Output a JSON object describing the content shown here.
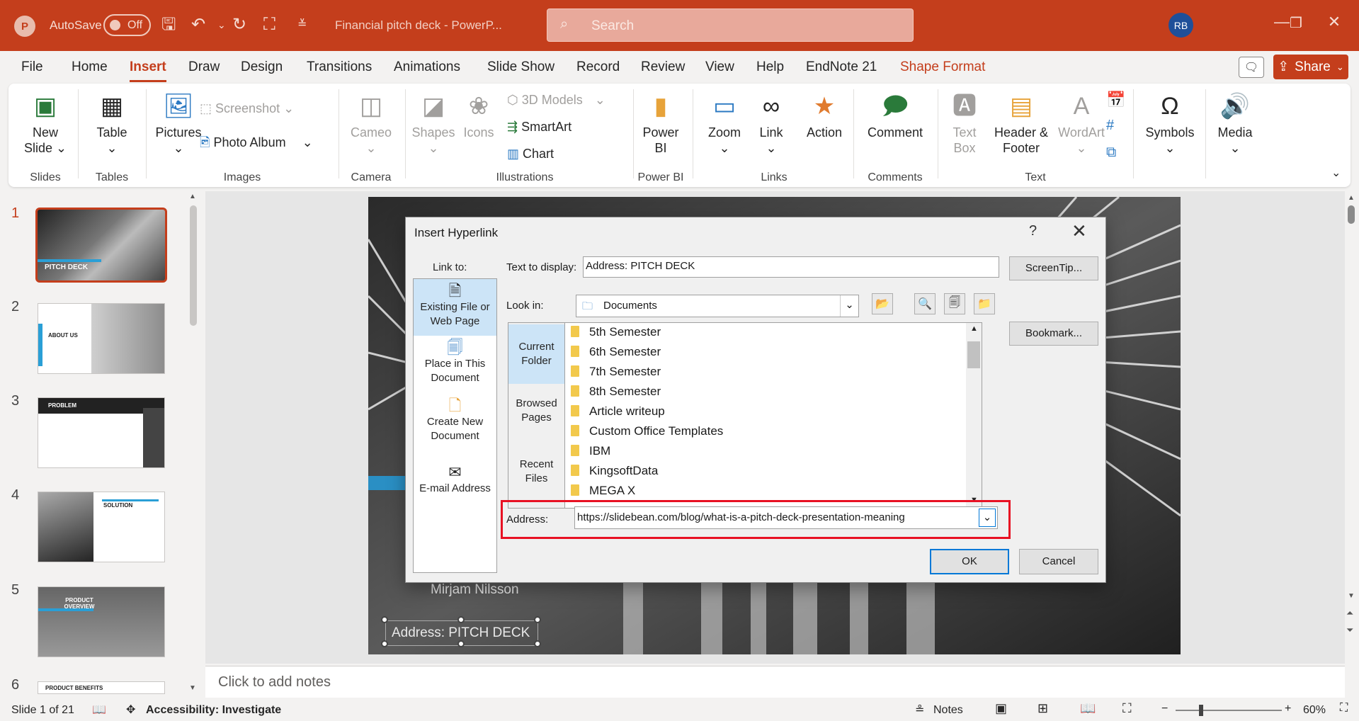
{
  "titlebar": {
    "autosave_label": "AutoSave",
    "autosave_state": "Off",
    "doc_title": "Financial pitch deck  -  PowerP...",
    "search_placeholder": "Search",
    "user_initials": "RB"
  },
  "menu": {
    "tabs": [
      "File",
      "Home",
      "Insert",
      "Draw",
      "Design",
      "Transitions",
      "Animations",
      "Slide Show",
      "Record",
      "Review",
      "View",
      "Help",
      "EndNote 21",
      "Shape Format"
    ],
    "active_tab": "Insert",
    "share_label": "Share"
  },
  "ribbon": {
    "slides": {
      "new_slide": "New Slide",
      "group": "Slides"
    },
    "tables": {
      "table": "Table",
      "group": "Tables"
    },
    "images": {
      "pictures": "Pictures",
      "screenshot": "Screenshot",
      "photo_album": "Photo Album",
      "group": "Images"
    },
    "camera": {
      "cameo": "Cameo",
      "group": "Camera"
    },
    "illustrations": {
      "shapes": "Shapes",
      "icons": "Icons",
      "models": "3D Models",
      "smartart": "SmartArt",
      "chart": "Chart",
      "group": "Illustrations"
    },
    "powerbi": {
      "power_bi": "Power BI",
      "group": "Power BI"
    },
    "links": {
      "zoom": "Zoom",
      "link": "Link",
      "action": "Action",
      "group": "Links"
    },
    "comments": {
      "comment": "Comment",
      "group": "Comments"
    },
    "text": {
      "text_box": "Text Box",
      "header_footer": "Header & Footer",
      "wordart": "WordArt",
      "group": "Text"
    },
    "symbols": {
      "symbols": "Symbols"
    },
    "media": {
      "media": "Media"
    }
  },
  "thumbnails": [
    {
      "num": "1",
      "title": "PITCH DECK"
    },
    {
      "num": "2",
      "title": "ABOUT US"
    },
    {
      "num": "3",
      "title": "PROBLEM"
    },
    {
      "num": "4",
      "title": "SOLUTION"
    },
    {
      "num": "5",
      "title": "PRODUCT OVERVIEW"
    },
    {
      "num": "6",
      "title": "PRODUCT BENEFITS"
    }
  ],
  "slide": {
    "presenter": "Mirjam Nilsson",
    "selected_text": "Address: PITCH DECK"
  },
  "notes_placeholder": "Click to add notes",
  "dialog": {
    "title": "Insert Hyperlink",
    "help": "?",
    "link_to_label": "Link to:",
    "link_to_items": [
      "Existing File or Web Page",
      "Place in This Document",
      "Create New Document",
      "E-mail Address"
    ],
    "text_to_display_label": "Text to display:",
    "text_to_display_value": "Address: PITCH DECK",
    "screentip_button": "ScreenTip...",
    "look_in_label": "Look in:",
    "look_in_value": "Documents",
    "nav_items": [
      "Current Folder",
      "Browsed Pages",
      "Recent Files"
    ],
    "folders": [
      "5th Semester",
      "6th Semester",
      "7th Semester",
      "8th Semester",
      "Article writeup",
      "Custom Office Templates",
      "IBM",
      "KingsoftData",
      "MEGA X"
    ],
    "bookmark_button": "Bookmark...",
    "address_label": "Address:",
    "address_value": "https://slidebean.com/blog/what-is-a-pitch-deck-presentation-meaning",
    "ok_button": "OK",
    "cancel_button": "Cancel"
  },
  "status": {
    "slide_counter": "Slide 1 of 21",
    "accessibility": "Accessibility: Investigate",
    "notes": "Notes",
    "zoom": "60%"
  },
  "colors": {
    "accent": "#c43e1c",
    "highlight": "#e81123",
    "selection": "#cce4f7"
  }
}
